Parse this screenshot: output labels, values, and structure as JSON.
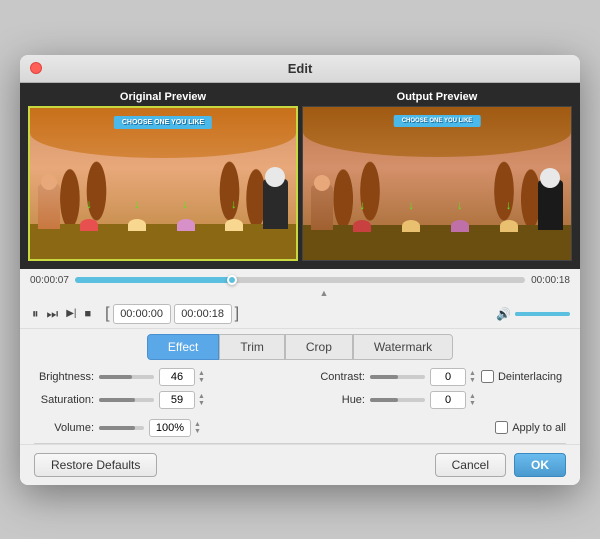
{
  "window": {
    "title": "Edit",
    "close_icon": "●"
  },
  "previews": {
    "original_label": "Original Preview",
    "output_label": "Output Preview",
    "sign_text": "CHOOSE ONE YOU LIKE"
  },
  "timeline": {
    "start_time": "00:00:07",
    "end_time": "00:00:18",
    "fill_percent": 35
  },
  "controls": {
    "pause_icon": "⏸",
    "step_forward_icon": "⏭",
    "frame_forward_icon": "▶|",
    "stop_icon": "■",
    "bracket_open": "[",
    "start_time": "00:00:00",
    "end_time": "00:00:18",
    "bracket_close": "]"
  },
  "tabs": [
    {
      "id": "effect",
      "label": "Effect",
      "active": true
    },
    {
      "id": "trim",
      "label": "Trim",
      "active": false
    },
    {
      "id": "crop",
      "label": "Crop",
      "active": false
    },
    {
      "id": "watermark",
      "label": "Watermark",
      "active": false
    }
  ],
  "params": {
    "brightness": {
      "label": "Brightness:",
      "value": "46",
      "fill_percent": 60
    },
    "contrast": {
      "label": "Contrast:",
      "value": "0",
      "fill_percent": 50
    },
    "saturation": {
      "label": "Saturation:",
      "value": "59",
      "fill_percent": 65
    },
    "hue": {
      "label": "Hue:",
      "value": "0",
      "fill_percent": 50
    },
    "volume": {
      "label": "Volume:",
      "value": "100%",
      "fill_percent": 80
    },
    "deinterlacing_label": "Deinterlacing",
    "apply_all_label": "Apply to all"
  },
  "footer": {
    "restore_label": "Restore Defaults",
    "cancel_label": "Cancel",
    "ok_label": "OK"
  },
  "food_items": [
    {
      "color": "#e85050"
    },
    {
      "color": "#f8d890"
    },
    {
      "color": "#d890c8"
    },
    {
      "color": "#f8d890"
    }
  ]
}
